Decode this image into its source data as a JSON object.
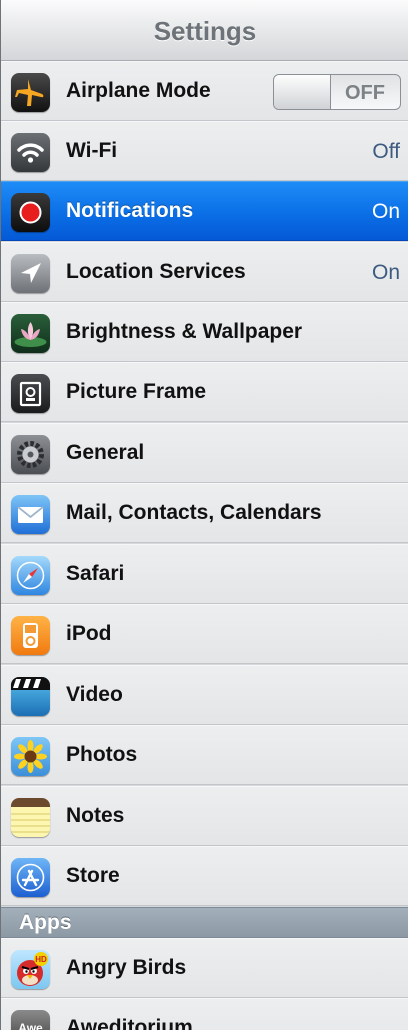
{
  "nav": {
    "title": "Settings"
  },
  "rows": [
    {
      "label": "Airplane Mode",
      "toggle": "OFF"
    },
    {
      "label": "Wi-Fi",
      "value": "Off"
    },
    {
      "label": "Notifications",
      "value": "On"
    },
    {
      "label": "Location Services",
      "value": "On"
    },
    {
      "label": "Brightness & Wallpaper"
    },
    {
      "label": "Picture Frame"
    },
    {
      "label": "General"
    },
    {
      "label": "Mail, Contacts, Calendars"
    },
    {
      "label": "Safari"
    },
    {
      "label": "iPod"
    },
    {
      "label": "Video"
    },
    {
      "label": "Photos"
    },
    {
      "label": "Notes"
    },
    {
      "label": "Store"
    }
  ],
  "apps_section": {
    "title": "Apps"
  },
  "apps": [
    {
      "label": "Angry Birds",
      "icon_text": "HD"
    },
    {
      "label": "Aweditorium",
      "icon_text": "Awe"
    }
  ],
  "colors": {
    "selected": "#0b6fe6",
    "value_text": "#3d5a80"
  }
}
